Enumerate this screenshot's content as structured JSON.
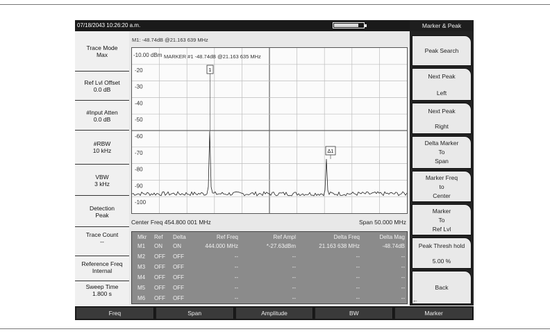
{
  "topbar": {
    "datetime": "07/18/2043 10:26:20 a.m.",
    "battery_level": 0.8
  },
  "left_menu": [
    {
      "line1": "Trace Mode",
      "line2": "Max"
    },
    {
      "line1": "Ref Lvl Offset",
      "line2": "0.0 dB"
    },
    {
      "line1": "#Input Atten",
      "line2": "0.0 dB"
    },
    {
      "line1": "#RBW",
      "line2": "10 kHz"
    },
    {
      "line1": "VBW",
      "line2": "3 kHz"
    },
    {
      "line1": "Detection",
      "line2": "Peak"
    },
    {
      "line1": "Trace Count",
      "line2": "--"
    },
    {
      "line1": "Reference Freq",
      "line2": "Internal"
    },
    {
      "line1": "Sweep Time",
      "line2": "1.800 s"
    }
  ],
  "marker_readout": "M1: -48.74dB @21.163 639 MHz",
  "plot": {
    "ref_label": "-10.00 dBm",
    "marker_annotation": "MARKER #1 -48.74dB @21.163 635 MHz",
    "y_tick_labels": [
      "-20",
      "-30",
      "-40",
      "-50",
      "-60",
      "-70",
      "-80",
      "-90",
      "-100"
    ],
    "marker1_label": "1",
    "delta_label": "∆1"
  },
  "center_freq": "Center Freq 454.800 001 MHz",
  "span": "Span 50.000 MHz",
  "marker_table": {
    "headers": [
      "Mkr",
      "Ref",
      "Delta",
      "Ref Freq",
      "Ref Ampl",
      "Delta Freq",
      "Delta Mag"
    ],
    "rows": [
      [
        "M1",
        "ON",
        "ON",
        "444.000 MHz",
        "*-27.63dBm",
        "21.163 638 MHz",
        "-48.74dB"
      ],
      [
        "M2",
        "OFF",
        "OFF",
        "--",
        "--",
        "--",
        "--"
      ],
      [
        "M3",
        "OFF",
        "OFF",
        "--",
        "--",
        "--",
        "--"
      ],
      [
        "M4",
        "OFF",
        "OFF",
        "--",
        "--",
        "--",
        "--"
      ],
      [
        "M5",
        "OFF",
        "OFF",
        "--",
        "--",
        "--",
        "--"
      ],
      [
        "M6",
        "OFF",
        "OFF",
        "--",
        "--",
        "--",
        "--"
      ]
    ]
  },
  "right_menu": {
    "title": "Marker & Peak",
    "buttons": [
      {
        "l1": "Peak Search",
        "l2": "",
        "l3": ""
      },
      {
        "l1": "Next Peak",
        "l2": "Left",
        "l3": ""
      },
      {
        "l1": "Next Peak",
        "l2": "Right",
        "l3": ""
      },
      {
        "l1": "Delta Marker",
        "l2": "To",
        "l3": "Span"
      },
      {
        "l1": "Marker Freq",
        "l2": "to",
        "l3": "Center"
      },
      {
        "l1": "Marker",
        "l2": "To",
        "l3": "Ref Lvl"
      },
      {
        "l1": "Peak Thresh hold",
        "l2": "5.00 %",
        "l3": ""
      },
      {
        "l1": "Back",
        "l2": "",
        "l3": ""
      }
    ],
    "back_hint": "←"
  },
  "bottom_tabs": [
    "Freq",
    "Span",
    "Amplitude",
    "BW",
    "Marker"
  ]
}
